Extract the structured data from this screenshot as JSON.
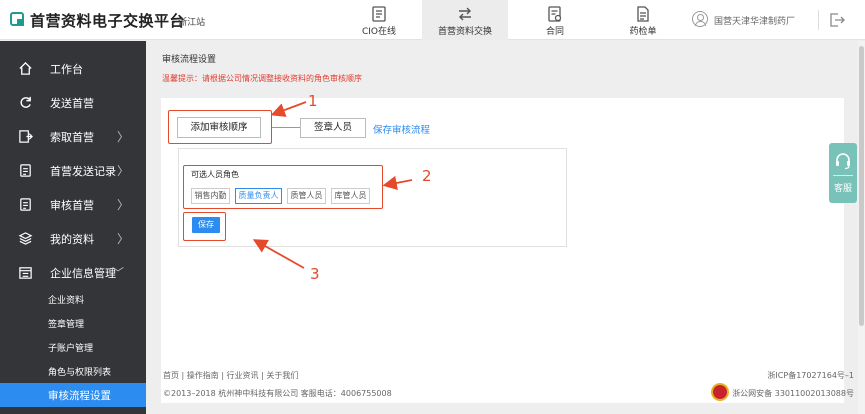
{
  "app": {
    "title": "首营资料电子交换平台",
    "station": "- 浙江站"
  },
  "nav": {
    "tabs": [
      {
        "label": "CIO在线",
        "icon": "document-icon"
      },
      {
        "label": "首营资料交换",
        "icon": "exchange-icon"
      },
      {
        "label": "合同",
        "icon": "contract-icon"
      },
      {
        "label": "药检单",
        "icon": "report-icon"
      }
    ],
    "active_tab": 1,
    "user": "国营天津华津制药厂"
  },
  "sidebar": {
    "items": [
      {
        "label": "工作台",
        "icon": "home-icon",
        "arrow": ""
      },
      {
        "label": "发送首营",
        "icon": "send-icon",
        "arrow": ""
      },
      {
        "label": "索取首营",
        "icon": "request-icon",
        "arrow": "〉"
      },
      {
        "label": "首营发送记录",
        "icon": "record-icon",
        "arrow": "〉"
      },
      {
        "label": "审核首营",
        "icon": "audit-icon",
        "arrow": "〉"
      },
      {
        "label": "我的资料",
        "icon": "layers-icon",
        "arrow": "〉"
      },
      {
        "label": "企业信息管理",
        "icon": "company-icon",
        "arrow": "﹀"
      }
    ],
    "subitems": [
      {
        "label": "企业资料"
      },
      {
        "label": "签章管理"
      },
      {
        "label": "子账户管理"
      },
      {
        "label": "角色与权限列表"
      },
      {
        "label": "审核流程设置"
      }
    ],
    "active_subitem": 4
  },
  "main": {
    "page_title": "审核流程设置",
    "tip": "温馨提示：请根据公司情况调整接收资料的角色审核顺序",
    "add_order_label": "添加审核顺序",
    "seal_person_label": "签章人员",
    "save_flow_label": "保存审核流程",
    "roles_title": "可选人员角色",
    "roles": [
      {
        "label": "销售内勤",
        "selected": false
      },
      {
        "label": "质量负责人",
        "selected": true
      },
      {
        "label": "质管人员",
        "selected": false
      },
      {
        "label": "库管人员",
        "selected": false
      }
    ],
    "save_label": "保存"
  },
  "annotations": {
    "numbers": [
      "1",
      "2",
      "3"
    ],
    "color": "#e54a2b"
  },
  "footer": {
    "links": "首页   |   操作指南   |   行业资讯   |   关于我们",
    "copyright": "©2013–2018   杭州神中科技有限公司   客服电话：4006755008",
    "icp": "浙ICP备17027164号–1",
    "police": "浙公网安备 33011002013088号"
  },
  "service": {
    "label": "客服"
  },
  "colors": {
    "accent": "#2d8cf0",
    "sidebar_bg": "#333538",
    "annotation": "#e54a2b",
    "tip_text": "#e23b2e",
    "service_bg": "#78c2ba"
  }
}
